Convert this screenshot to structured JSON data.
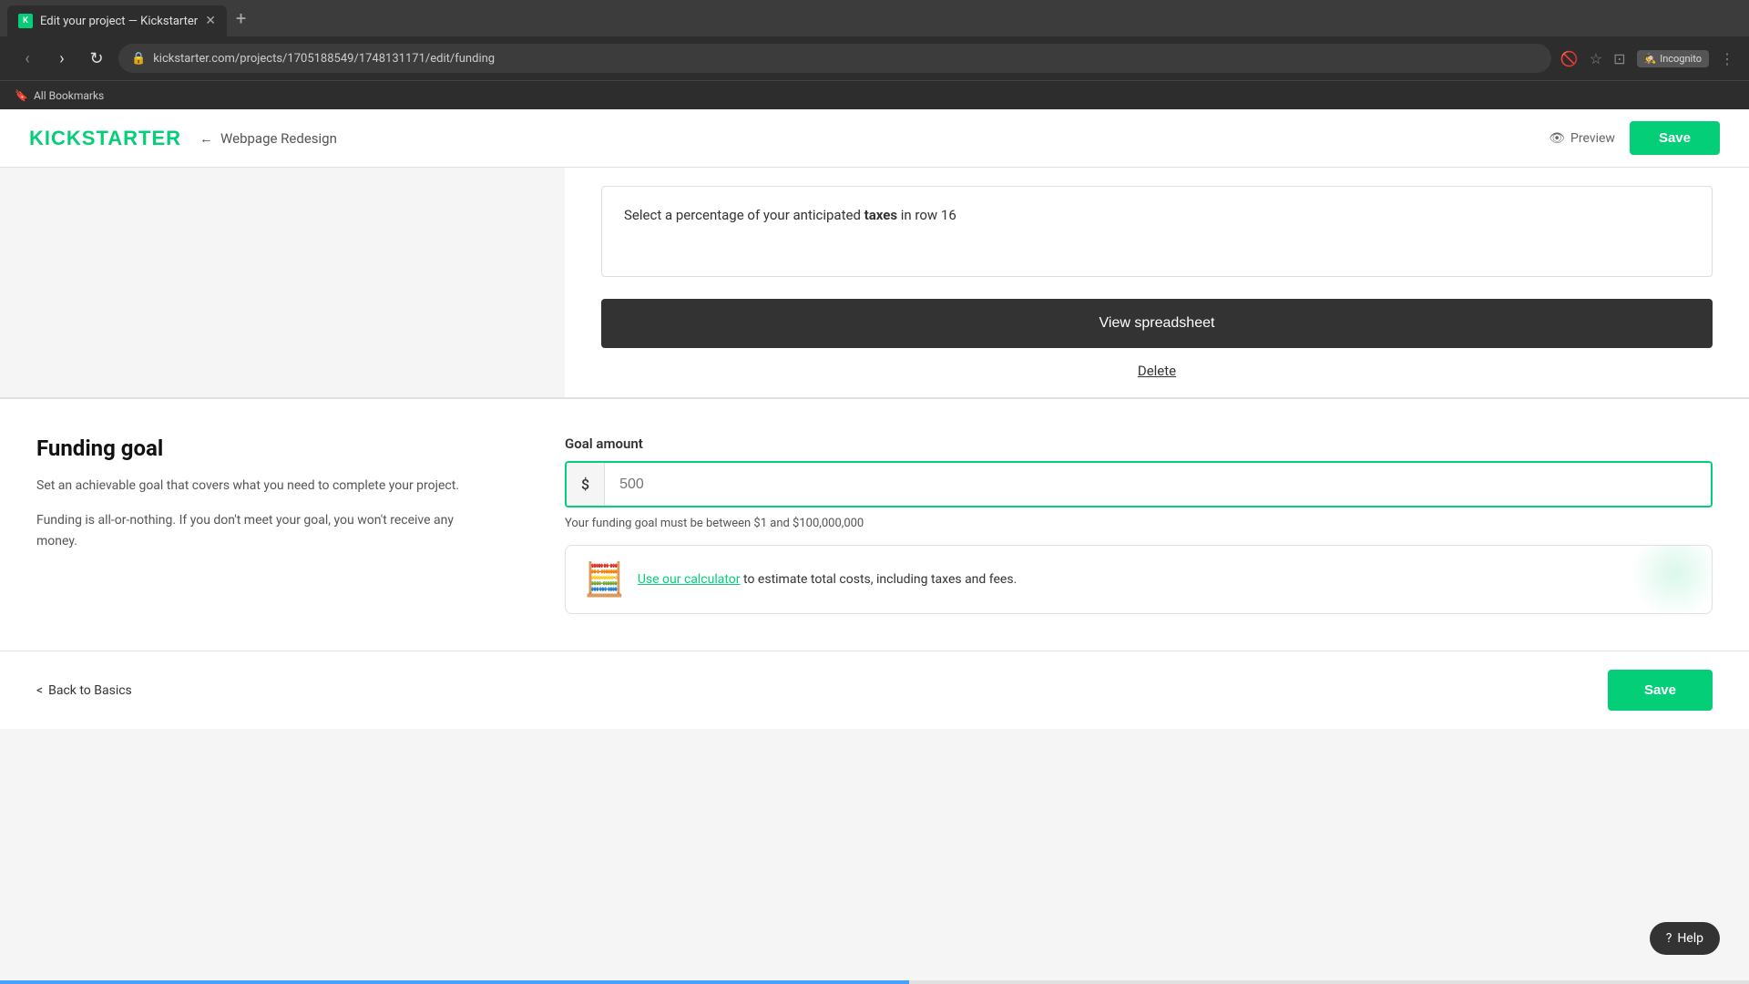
{
  "browser": {
    "tab_title": "Edit your project — Kickstarter",
    "tab_new": "+",
    "url": "kickstarter.com/projects/1705188549/1748131171/edit/funding",
    "incognito_label": "Incognito",
    "bookmarks_label": "All Bookmarks"
  },
  "header": {
    "logo": "KICKSTARTER",
    "back_arrow": "←",
    "project_name": "Webpage Redesign",
    "preview_label": "Preview",
    "save_label": "Save"
  },
  "spreadsheet": {
    "hint_text_part1": "Select a percentage of your anticipated ",
    "hint_text_bold": "taxes",
    "hint_text_part2": " in row 16",
    "view_spreadsheet_label": "View spreadsheet",
    "delete_label": "Delete"
  },
  "funding": {
    "title": "Funding goal",
    "desc1": "Set an achievable goal that covers what you need to complete your project.",
    "desc2": "Funding is all-or-nothing. If you don't meet your goal, you won't receive any money.",
    "goal_amount_label": "Goal amount",
    "currency_symbol": "$",
    "goal_placeholder": "500",
    "goal_hint": "Your funding goal must be between $1 and $100,000,000",
    "calc_icon": "🧮",
    "calc_text_part1": "Use our calculator",
    "calc_text_part2": " to estimate total costs, including taxes and fees."
  },
  "bottom_nav": {
    "back_arrow": "<",
    "back_label": "Back to Basics",
    "save_label": "Save"
  },
  "help": {
    "icon": "?",
    "label": "Help"
  }
}
